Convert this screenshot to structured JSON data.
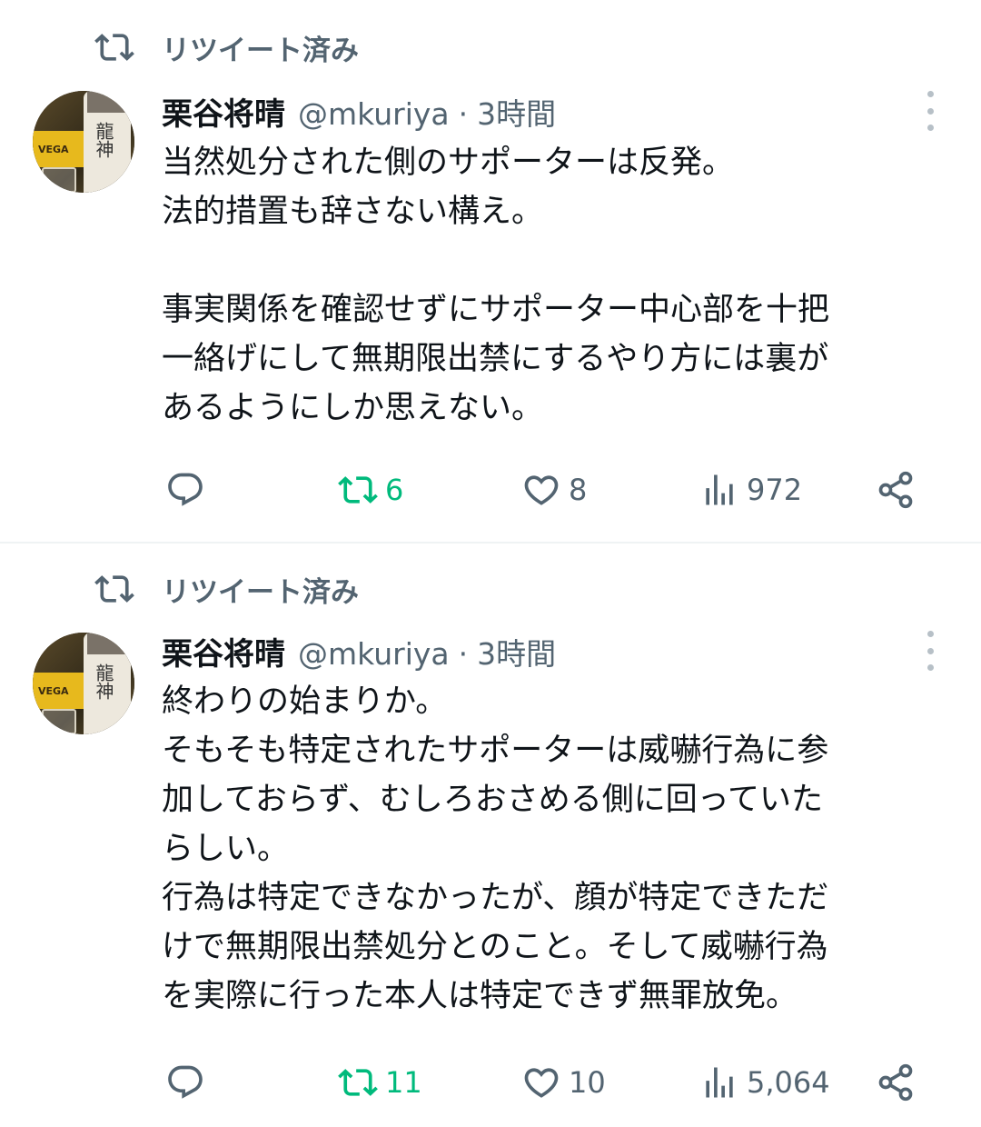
{
  "colors": {
    "retweet_green": "#00ba7c",
    "secondary_text": "#536471",
    "primary_text": "#0f1419",
    "divider": "#eff3f4"
  },
  "tweets": [
    {
      "retweet_label": "リツイート済み",
      "author": {
        "name": "栗谷将晴",
        "handle": "@mkuriya",
        "avatar_icon": "profile-photo"
      },
      "separator": "·",
      "time": "3時間",
      "lines": [
        "当然処分された側のサポーターは反発。",
        "法的措置も辞さない構え。",
        "",
        "事実関係を確認せずにサポーター中心部を十把",
        "一絡げにして無期限出禁にするやり方には裏が",
        "あるようにしか思えない。"
      ],
      "actions": {
        "replies": "",
        "retweets": "6",
        "likes": "8",
        "views": "972"
      }
    },
    {
      "retweet_label": "リツイート済み",
      "author": {
        "name": "栗谷将晴",
        "handle": "@mkuriya",
        "avatar_icon": "profile-photo"
      },
      "separator": "·",
      "time": "3時間",
      "lines": [
        "終わりの始まりか。",
        "そもそも特定されたサポーターは威嚇行為に参",
        "加しておらず、むしろおさめる側に回っていた",
        "らしい。",
        "行為は特定できなかったが、顔が特定できただ",
        "けで無期限出禁処分とのこと。そして威嚇行為",
        "を実際に行った本人は特定できず無罪放免。"
      ],
      "actions": {
        "replies": "",
        "retweets": "11",
        "likes": "10",
        "views": "5,064"
      }
    }
  ]
}
